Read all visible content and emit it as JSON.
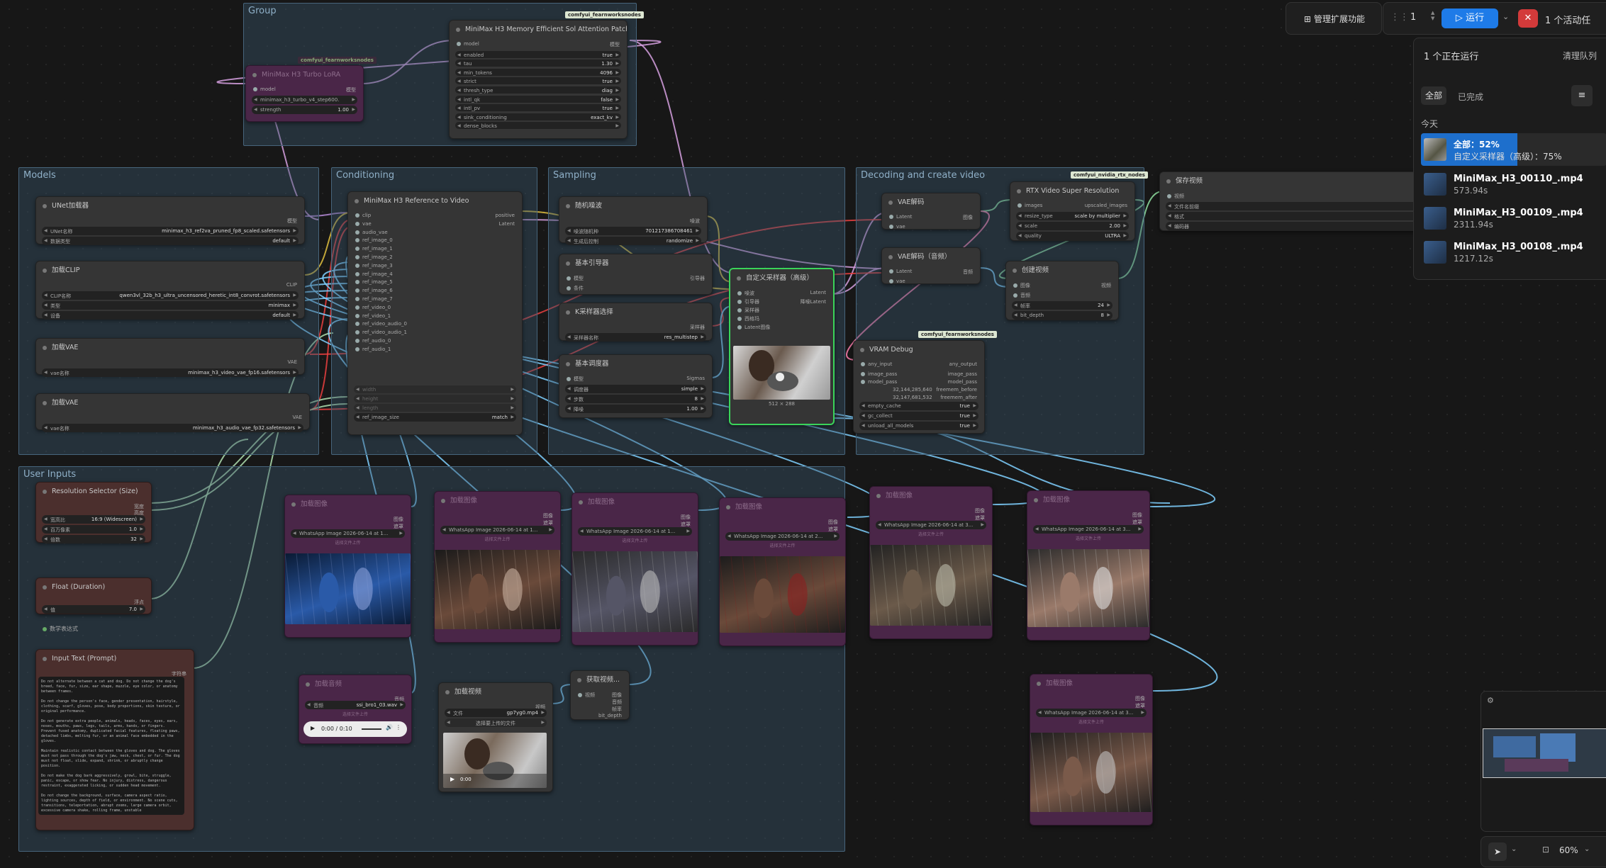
{
  "groups": {
    "group": "Group",
    "models": "Models",
    "conditioning": "Conditioning",
    "sampling": "Sampling",
    "decoding": "Decoding and create video",
    "user_inputs": "User Inputs"
  },
  "tags": {
    "fearnworks": "comfyui_fearnworksnodes",
    "rtx": "comfyui_nvidia_rtx_nodes",
    "fearnworks2": "comfyui_fearnworksnodes",
    "fearnworks3": "comfyui_fearnworksnodes"
  },
  "nodes": {
    "attn": {
      "title": "MiniMax H3 Memory Efficient Sol Attention Patch",
      "in_model": "model",
      "out_model": "模型",
      "w": [
        [
          "enabled",
          "true"
        ],
        [
          "tau",
          "1.30"
        ],
        [
          "min_tokens",
          "4096"
        ],
        [
          "strict",
          "true"
        ],
        [
          "thresh_type",
          "diag"
        ],
        [
          "intl_qk",
          "false"
        ],
        [
          "intl_pv",
          "true"
        ],
        [
          "sink_conditioning",
          "exact_kv"
        ],
        [
          "dense_blocks",
          ""
        ]
      ]
    },
    "lora": {
      "title": "MiniMax H3 Turbo LoRA",
      "in": "model",
      "out": "模型",
      "w1": "minimax_h3_turbo_v4_step600.",
      "w2": "strength",
      "w2v": "1.00"
    },
    "unet": {
      "title": "UNet加载器",
      "out": "模型",
      "w": [
        [
          "UNet名称",
          "minimax_h3_ref2va_pruned_fp8_scaled.safetensors"
        ],
        [
          "数据类型",
          "default"
        ]
      ]
    },
    "clip": {
      "title": "加载CLIP",
      "out": "CLIP",
      "w": [
        [
          "CLIP名称",
          "qwen3vl_32b_h3_ultra_uncensored_heretic_int8_convrot.safetensors"
        ],
        [
          "类型",
          "minimax"
        ],
        [
          "设备",
          "default"
        ]
      ]
    },
    "vae1": {
      "title": "加载VAE",
      "out": "VAE",
      "w": [
        [
          "vae名称",
          "minimax_h3_video_vae_fp16.safetensors"
        ]
      ]
    },
    "vae2": {
      "title": "加载VAE",
      "out": "VAE",
      "w": [
        [
          "vae名称",
          "minimax_h3_audio_vae_fp32.safetensors"
        ]
      ]
    },
    "ref": {
      "title": "MiniMax H3 Reference to Video",
      "ins": [
        "clip",
        "vae",
        "audio_vae",
        "ref_image_0",
        "ref_image_1",
        "ref_image_2",
        "ref_image_3",
        "ref_image_4",
        "ref_image_5",
        "ref_image_6",
        "ref_image_7",
        "ref_video_0",
        "ref_video_1",
        "ref_video_audio_0",
        "ref_video_audio_1",
        "ref_audio_0",
        "ref_audio_1"
      ],
      "outs": [
        "positive",
        "Latent"
      ],
      "params": [
        "width",
        "height",
        "length"
      ],
      "w": [
        [
          "ref_image_size",
          "match"
        ]
      ]
    },
    "noise": {
      "title": "随机噪波",
      "out": "噪波",
      "w": [
        [
          "噪波随机种",
          "701217386708461"
        ],
        [
          "生成后控制",
          "randomize"
        ]
      ]
    },
    "guider": {
      "title": "基本引导器",
      "ins": [
        "模型",
        "条件"
      ],
      "out": "引导器"
    },
    "ksel": {
      "title": "K采样器选择",
      "out": "采样器",
      "w": [
        [
          "采样器名称",
          "res_multistep"
        ]
      ]
    },
    "sched": {
      "title": "基本调度器",
      "in": "模型",
      "out": "Sigmas",
      "w": [
        [
          "调度器",
          "simple"
        ],
        [
          "步数",
          "8"
        ],
        [
          "降噪",
          "1.00"
        ]
      ]
    },
    "custom": {
      "title": "自定义采样器（高级）",
      "ins": [
        "噪波",
        "引导器",
        "采样器",
        "西格玛",
        "Latent图像"
      ],
      "outs": [
        "Latent",
        "降噪Latent"
      ],
      "caption": "512 × 288"
    },
    "vaedec": {
      "title": "VAE解码",
      "ins": [
        "Latent",
        "vae"
      ],
      "out": "图像"
    },
    "vaedec_audio": {
      "title": "VAE解码（音频）",
      "ins": [
        "Latent",
        "vae"
      ],
      "out": "音频"
    },
    "rtx": {
      "title": "RTX Video Super Resolution",
      "in": "images",
      "out": "upscaled_images",
      "w": [
        [
          "resize_type",
          "scale by multiplier"
        ],
        [
          "scale",
          "2.00"
        ],
        [
          "quality",
          "ULTRA"
        ]
      ]
    },
    "create": {
      "title": "创建视频",
      "ins": [
        "图像",
        "音频"
      ],
      "out": "视频",
      "w": [
        [
          "帧率",
          "24"
        ],
        [
          "bit_depth",
          "8"
        ]
      ]
    },
    "save": {
      "title": "保存视频",
      "in": "视频",
      "w": [
        [
          "文件名前缀",
          ""
        ],
        [
          "格式",
          ""
        ],
        [
          "编码器",
          ""
        ]
      ]
    },
    "vram": {
      "title": "VRAM Debug",
      "ins": [
        "any_input",
        "image_pass",
        "model_pass"
      ],
      "outs": [
        "any_output",
        "image_pass",
        "model_pass"
      ],
      "r1a": "32,144,285,640",
      "r1b": "freemem_before",
      "r2a": "32,147,681,532",
      "r2b": "freemem_after",
      "w": [
        [
          "empty_cache",
          "true"
        ],
        [
          "gc_collect",
          "true"
        ],
        [
          "unload_all_models",
          "true"
        ]
      ]
    },
    "res": {
      "title": "Resolution Selector (Size)",
      "outs": [
        "宽度",
        "高度"
      ],
      "w": [
        [
          "宽高比",
          "16:9 (Widescreen)"
        ],
        [
          "百万像素",
          "1.0"
        ],
        [
          "倍数",
          "32"
        ]
      ]
    },
    "float": {
      "title": "Float (Duration)",
      "out": "浮点",
      "w": [
        [
          "值",
          "7.0"
        ]
      ]
    },
    "math": {
      "label": "数学表达式"
    },
    "prompt": {
      "title": "Input Text (Prompt)",
      "out": "字符串",
      "text": "Do not alternate between a cat and dog. Do not change the dog's breed, face, fur, size, ear shape, muzzle, eye color, or anatomy between frames.\n\nDo not change the person's face, gender presentation, hairstyle, clothing, scarf, gloves, pose, body proportions, skin texture, or original performance.\n\nDo not generate extra people, animals, heads, faces, eyes, ears, noses, mouths, paws, legs, tails, arms, hands, or fingers. Prevent fused anatomy, duplicated facial features, floating paws, detached limbs, melting fur, or an animal face embedded in the gloves.\n\nMaintain realistic contact between the gloves and dog. The gloves must not pass through the dog's jaw, neck, chest, or fur. The dog must not float, slide, expand, shrink, or abruptly change position.\n\nDo not make the dog bark aggressively, growl, bite, struggle, panic, escape, or show fear. No injury, distress, dangerous restraint, exaggerated licking, or sudden head movement.\n\nDo not change the background, surface, camera aspect ratio, lighting sources, depth of field, or environment. No scene cuts, transitions, teleportation, abrupt zooms, large camera orbit, excessive camera shake, rolling frame, unstable"
    },
    "img1": {
      "title": "加载图像",
      "outs": [
        "图像",
        "遮罩"
      ],
      "file": "WhatsApp Image 2026-06-14 at 1...",
      "choose": "选择文件上传"
    },
    "img2": {
      "title": "加载图像",
      "outs": [
        "图像",
        "遮罩"
      ],
      "file": "WhatsApp Image 2026-06-14 at 1...",
      "choose": "选择文件上传"
    },
    "img3": {
      "title": "加载图像",
      "outs": [
        "图像",
        "遮罩"
      ],
      "file": "WhatsApp Image 2026-06-14 at 1...",
      "choose": "选择文件上传"
    },
    "img4": {
      "title": "加载图像",
      "outs": [
        "图像",
        "遮罩"
      ],
      "file": "WhatsApp Image 2026-06-14 at 2...",
      "choose": "选择文件上传"
    },
    "img5": {
      "title": "加载图像",
      "outs": [
        "图像",
        "遮罩"
      ],
      "file": "WhatsApp Image 2026-06-14 at 3...",
      "choose": "选择文件上传"
    },
    "img6": {
      "title": "加载图像",
      "outs": [
        "图像",
        "遮罩"
      ],
      "file": "WhatsApp Image 2026-06-14 at 3...",
      "choose": "选择文件上传"
    },
    "img7": {
      "title": "加载图像",
      "outs": [
        "图像",
        "遮罩"
      ],
      "file": "WhatsApp Image 2026-06-14 at 3...",
      "choose": "选择文件上传"
    },
    "audio": {
      "title": "加载音频",
      "out": "音频",
      "w": [
        [
          "音频",
          "ssi_bro1_03.wav"
        ]
      ],
      "choose": "选择文件上传",
      "time": "0:00 / 0:10"
    },
    "video": {
      "title": "加载视频",
      "out": "视频",
      "w": [
        [
          "文件",
          "gp7yg0.mp4"
        ]
      ],
      "choose": "选择要上传的文件",
      "time": "0:00"
    },
    "getvid": {
      "title": "获取视频...",
      "ins": [
        "视频"
      ],
      "outs": [
        "图像",
        "音频",
        "帧率",
        "bit_depth"
      ]
    }
  },
  "toolbar": {
    "manage": "管理扩展功能",
    "count": "1",
    "run": "运行",
    "active": "1 个活动任"
  },
  "queue": {
    "title": "1 个正在运行",
    "clear": "清理队列",
    "tab_all": "全部",
    "tab_done": "已完成",
    "today": "今天",
    "running_name": "全部：52%",
    "running_sub": "自定义采样器（高级）：75%",
    "items": [
      {
        "name": "MiniMax_H3_00110_.mp4",
        "time": "573.94s"
      },
      {
        "name": "MiniMax_H3_00109_.mp4",
        "time": "2311.94s"
      },
      {
        "name": "MiniMax_H3_00108_.mp4",
        "time": "1217.12s"
      }
    ]
  },
  "zoom": "60%",
  "colors": {
    "run": "#1e7be8",
    "stop": "#d33a3a",
    "selected": "#3ad45a",
    "group": "#47657c"
  }
}
